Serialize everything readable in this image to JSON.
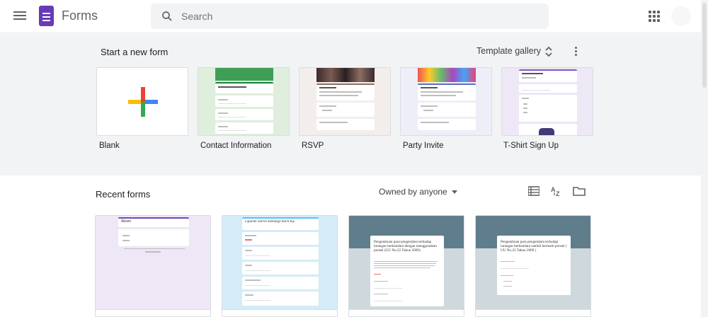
{
  "app": {
    "title": "Forms"
  },
  "search": {
    "placeholder": "Search"
  },
  "start_section": {
    "title": "Start a new form",
    "gallery_label": "Template gallery",
    "templates": [
      {
        "label": "Blank"
      },
      {
        "label": "Contact Information"
      },
      {
        "label": "RSVP"
      },
      {
        "label": "Party Invite"
      },
      {
        "label": "T-Shirt Sign Up"
      }
    ]
  },
  "recent_section": {
    "title": "Recent forms",
    "owner_filter": "Owned by anyone",
    "forms": [
      {
        "thumb_title": "Absen",
        "accent": "#7248b9",
        "bg": "#ece7f6"
      },
      {
        "thumb_title": "Laporan Survei Keluarga KKN Kp",
        "accent": "#4fc3f7",
        "bg": "#d4ecf8"
      },
      {
        "thumb_title": "Pengetahuan para pengendara terhadap larangan berkendara dengan menggunakan ponsel (UU No.22 Tahun 2009)",
        "accent": "#607d8b",
        "bg": "#cfd8dc"
      },
      {
        "thumb_title": "Pengetahuan para pengendara terhadap larangan berkendara sambil bermain ponsel ( UU No.22 Tahun 2009 )",
        "accent": "#607d8b",
        "bg": "#cfd8dc"
      }
    ]
  },
  "colors": {
    "brand": "#673ab7",
    "section_bg": "#f1f3f4"
  }
}
